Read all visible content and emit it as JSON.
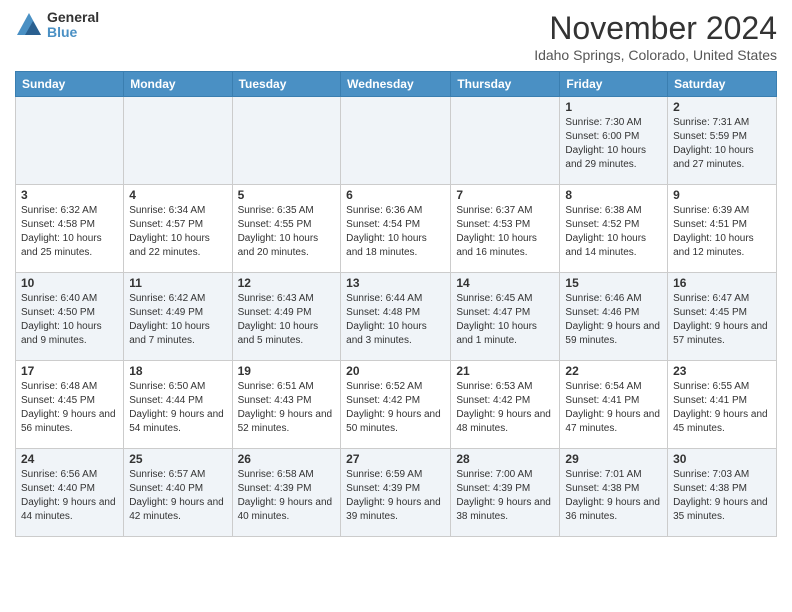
{
  "logo": {
    "general": "General",
    "blue": "Blue"
  },
  "header": {
    "month": "November 2024",
    "location": "Idaho Springs, Colorado, United States"
  },
  "weekdays": [
    "Sunday",
    "Monday",
    "Tuesday",
    "Wednesday",
    "Thursday",
    "Friday",
    "Saturday"
  ],
  "weeks": [
    [
      {
        "day": "",
        "info": ""
      },
      {
        "day": "",
        "info": ""
      },
      {
        "day": "",
        "info": ""
      },
      {
        "day": "",
        "info": ""
      },
      {
        "day": "",
        "info": ""
      },
      {
        "day": "1",
        "info": "Sunrise: 7:30 AM\nSunset: 6:00 PM\nDaylight: 10 hours and 29 minutes."
      },
      {
        "day": "2",
        "info": "Sunrise: 7:31 AM\nSunset: 5:59 PM\nDaylight: 10 hours and 27 minutes."
      }
    ],
    [
      {
        "day": "3",
        "info": "Sunrise: 6:32 AM\nSunset: 4:58 PM\nDaylight: 10 hours and 25 minutes."
      },
      {
        "day": "4",
        "info": "Sunrise: 6:34 AM\nSunset: 4:57 PM\nDaylight: 10 hours and 22 minutes."
      },
      {
        "day": "5",
        "info": "Sunrise: 6:35 AM\nSunset: 4:55 PM\nDaylight: 10 hours and 20 minutes."
      },
      {
        "day": "6",
        "info": "Sunrise: 6:36 AM\nSunset: 4:54 PM\nDaylight: 10 hours and 18 minutes."
      },
      {
        "day": "7",
        "info": "Sunrise: 6:37 AM\nSunset: 4:53 PM\nDaylight: 10 hours and 16 minutes."
      },
      {
        "day": "8",
        "info": "Sunrise: 6:38 AM\nSunset: 4:52 PM\nDaylight: 10 hours and 14 minutes."
      },
      {
        "day": "9",
        "info": "Sunrise: 6:39 AM\nSunset: 4:51 PM\nDaylight: 10 hours and 12 minutes."
      }
    ],
    [
      {
        "day": "10",
        "info": "Sunrise: 6:40 AM\nSunset: 4:50 PM\nDaylight: 10 hours and 9 minutes."
      },
      {
        "day": "11",
        "info": "Sunrise: 6:42 AM\nSunset: 4:49 PM\nDaylight: 10 hours and 7 minutes."
      },
      {
        "day": "12",
        "info": "Sunrise: 6:43 AM\nSunset: 4:49 PM\nDaylight: 10 hours and 5 minutes."
      },
      {
        "day": "13",
        "info": "Sunrise: 6:44 AM\nSunset: 4:48 PM\nDaylight: 10 hours and 3 minutes."
      },
      {
        "day": "14",
        "info": "Sunrise: 6:45 AM\nSunset: 4:47 PM\nDaylight: 10 hours and 1 minute."
      },
      {
        "day": "15",
        "info": "Sunrise: 6:46 AM\nSunset: 4:46 PM\nDaylight: 9 hours and 59 minutes."
      },
      {
        "day": "16",
        "info": "Sunrise: 6:47 AM\nSunset: 4:45 PM\nDaylight: 9 hours and 57 minutes."
      }
    ],
    [
      {
        "day": "17",
        "info": "Sunrise: 6:48 AM\nSunset: 4:45 PM\nDaylight: 9 hours and 56 minutes."
      },
      {
        "day": "18",
        "info": "Sunrise: 6:50 AM\nSunset: 4:44 PM\nDaylight: 9 hours and 54 minutes."
      },
      {
        "day": "19",
        "info": "Sunrise: 6:51 AM\nSunset: 4:43 PM\nDaylight: 9 hours and 52 minutes."
      },
      {
        "day": "20",
        "info": "Sunrise: 6:52 AM\nSunset: 4:42 PM\nDaylight: 9 hours and 50 minutes."
      },
      {
        "day": "21",
        "info": "Sunrise: 6:53 AM\nSunset: 4:42 PM\nDaylight: 9 hours and 48 minutes."
      },
      {
        "day": "22",
        "info": "Sunrise: 6:54 AM\nSunset: 4:41 PM\nDaylight: 9 hours and 47 minutes."
      },
      {
        "day": "23",
        "info": "Sunrise: 6:55 AM\nSunset: 4:41 PM\nDaylight: 9 hours and 45 minutes."
      }
    ],
    [
      {
        "day": "24",
        "info": "Sunrise: 6:56 AM\nSunset: 4:40 PM\nDaylight: 9 hours and 44 minutes."
      },
      {
        "day": "25",
        "info": "Sunrise: 6:57 AM\nSunset: 4:40 PM\nDaylight: 9 hours and 42 minutes."
      },
      {
        "day": "26",
        "info": "Sunrise: 6:58 AM\nSunset: 4:39 PM\nDaylight: 9 hours and 40 minutes."
      },
      {
        "day": "27",
        "info": "Sunrise: 6:59 AM\nSunset: 4:39 PM\nDaylight: 9 hours and 39 minutes."
      },
      {
        "day": "28",
        "info": "Sunrise: 7:00 AM\nSunset: 4:39 PM\nDaylight: 9 hours and 38 minutes."
      },
      {
        "day": "29",
        "info": "Sunrise: 7:01 AM\nSunset: 4:38 PM\nDaylight: 9 hours and 36 minutes."
      },
      {
        "day": "30",
        "info": "Sunrise: 7:03 AM\nSunset: 4:38 PM\nDaylight: 9 hours and 35 minutes."
      }
    ]
  ]
}
